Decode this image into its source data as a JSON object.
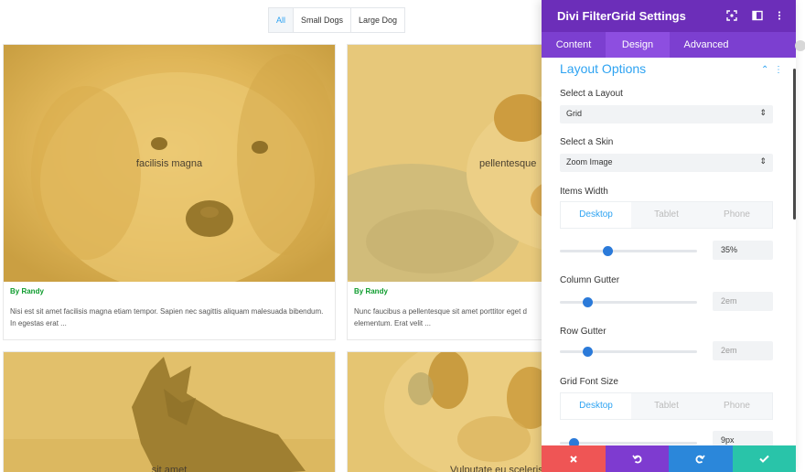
{
  "filters": [
    "All",
    "Small Dogs",
    "Large Dog"
  ],
  "cards": [
    {
      "caption": "facilisis magna",
      "author": "By Randy",
      "excerpt": "Nisi est sit amet facilisis magna etiam tempor. Sapien nec sagittis aliquam malesuada bibendum. In egestas erat ..."
    },
    {
      "caption": "pellentesque",
      "author": "By Randy",
      "excerpt": "Nunc faucibus a pellentesque sit amet porttitor eget d elementum. Erat velit ..."
    },
    {
      "caption": "sit amet"
    },
    {
      "caption": "Vulputate eu scelerisque"
    }
  ],
  "panel": {
    "title": "Divi FilterGrid Settings",
    "tabs": [
      "Content",
      "Design",
      "Advanced"
    ],
    "section_title": "Layout Options",
    "layout_label": "Select a Layout",
    "layout_value": "Grid",
    "skin_label": "Select a Skin",
    "skin_value": "Zoom Image",
    "items_width_label": "Items Width",
    "device_tabs": [
      "Desktop",
      "Tablet",
      "Phone"
    ],
    "items_width_value": "35%",
    "column_gutter_label": "Column Gutter",
    "column_gutter_value": "2em",
    "row_gutter_label": "Row Gutter",
    "row_gutter_value": "2em",
    "grid_font_size_label": "Grid Font Size",
    "grid_font_size_value": "9px",
    "sliders": {
      "items_width": 0.35,
      "column_gutter": 0.2,
      "row_gutter": 0.2,
      "grid_font_size": 0.1
    }
  },
  "colors": {
    "header": "#6c2eb9",
    "tabs_bar": "#7c3fd0",
    "accent": "#2ea3f2",
    "author": "#0c9b2c",
    "cancel": "#ef5555",
    "undo": "#7e3bd0",
    "redo": "#2b87da",
    "save": "#29c4a9"
  }
}
